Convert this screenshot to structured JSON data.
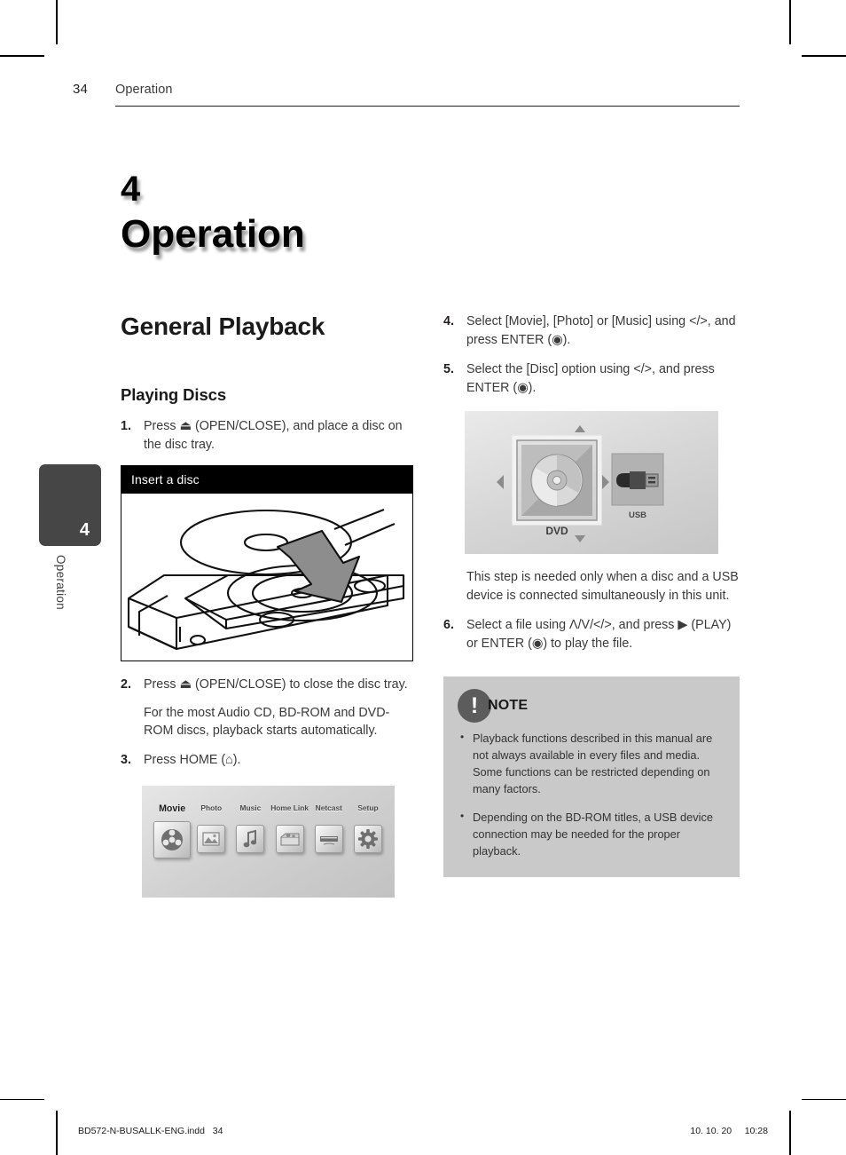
{
  "header": {
    "page_number": "34",
    "section": "Operation"
  },
  "chapter": {
    "number": "4",
    "name": "Operation"
  },
  "side_tab": {
    "number": "4",
    "label": "Operation"
  },
  "left_column": {
    "section_title": "General Playback",
    "sub_title": "Playing Discs",
    "steps": [
      {
        "marker": "1.",
        "text": "Press ⏏ (OPEN/CLOSE), and place a disc on the disc tray."
      },
      {
        "marker": "2.",
        "text": "Press ⏏ (OPEN/CLOSE) to close the disc tray.",
        "extra": "For the most Audio CD, BD-ROM and DVD-ROM discs, playback starts automatically."
      },
      {
        "marker": "3.",
        "text": "Press HOME (⌂)."
      }
    ],
    "figure_disc": {
      "caption": "Insert a disc"
    },
    "figure_home": {
      "items": [
        {
          "label": "Movie",
          "icon": "movie-reel-icon",
          "selected": true
        },
        {
          "label": "Photo",
          "icon": "photo-icon",
          "selected": false
        },
        {
          "label": "Music",
          "icon": "music-note-icon",
          "selected": false
        },
        {
          "label": "Home Link",
          "icon": "home-link-icon",
          "selected": false
        },
        {
          "label": "Netcast",
          "icon": "netcast-icon",
          "selected": false
        },
        {
          "label": "Setup",
          "icon": "gear-icon",
          "selected": false
        }
      ]
    }
  },
  "right_column": {
    "steps": [
      {
        "marker": "4.",
        "text": "Select [Movie], [Photo] or [Music] using </>, and press ENTER (◉)."
      },
      {
        "marker": "5.",
        "text": "Select the [Disc] option using </>, and press ENTER (◉)."
      },
      {
        "marker": "6.",
        "text": "Select a file using Λ/V/</>, and press ▶ (PLAY) or ENTER (◉) to play the file."
      }
    ],
    "figure_source": {
      "dvd_label": "DVD",
      "usb_label": "USB"
    },
    "note_paragraph": "This step is needed only when a disc and a USB device is connected simultaneously in this unit.",
    "note": {
      "title": "NOTE",
      "icon": "exclamation-icon",
      "bullets": [
        "Playback functions described in this manual are not always available in every files and media. Some functions can be restricted depending on many factors.",
        "Depending on the BD-ROM titles, a USB device connection may be needed for the proper playback."
      ]
    }
  },
  "footer": {
    "file_name": "BD572-N-BUSALLK-ENG.indd   34",
    "timestamp": "10. 10. 20     10:28"
  },
  "colors": {
    "tab_background": "#464646",
    "note_background": "#c9c9c9",
    "note_icon": "#5c5c5c",
    "caption_bar": "#000000"
  }
}
